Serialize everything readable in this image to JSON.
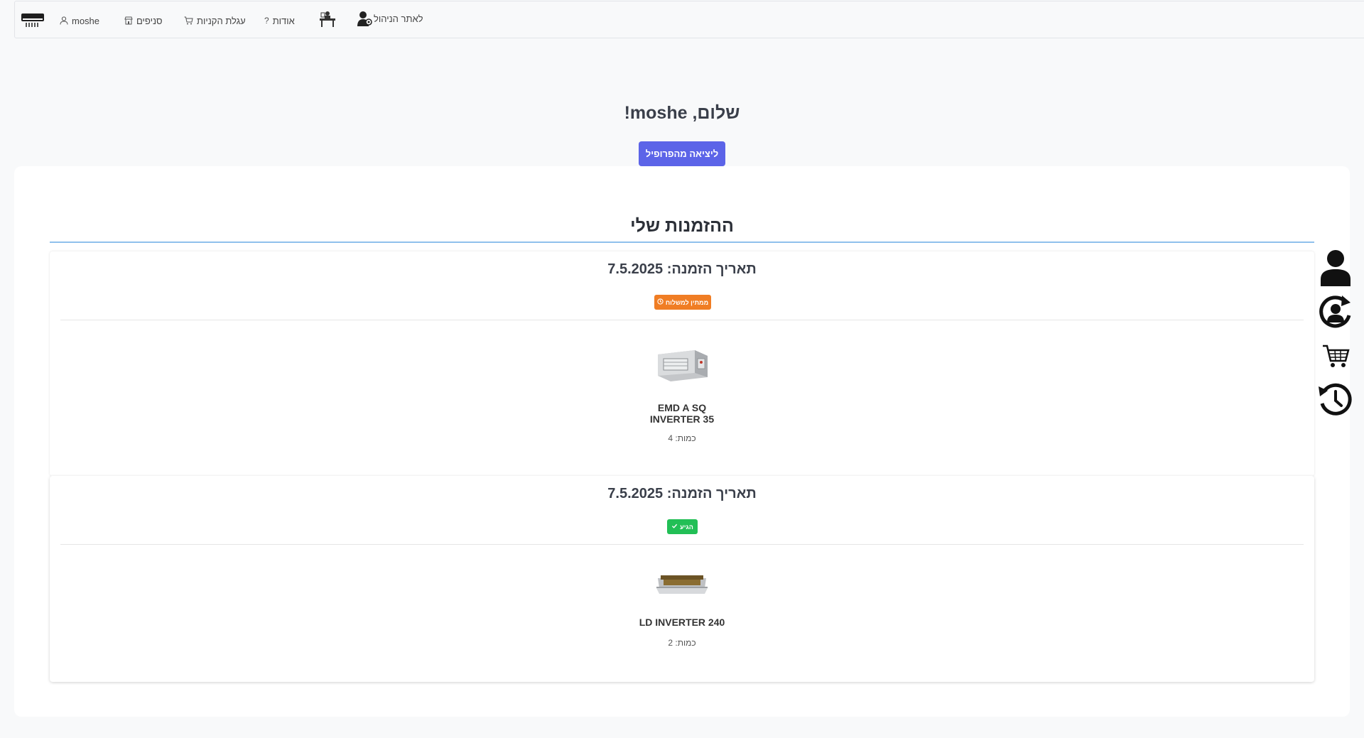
{
  "nav": {
    "logo_icon": "air-conditioner-icon",
    "user_label": "moshe",
    "categories_label": "סניפים",
    "cart_label": "עגלת הקניות",
    "about_label": "אודות",
    "workshop_icon": "technician-icon",
    "admin_label": "לאתר הניהול"
  },
  "greeting": "שלום, moshe!",
  "logout_label": "ליציאה מהפרופיל",
  "orders_title": "ההזמנות שלי",
  "orders": [
    {
      "date": "תאריך הזמנה: 7.5.2025",
      "status": "ממתין למשלוח",
      "status_icon": "clock-icon",
      "status_color": "#f07d24",
      "product_name": "EMD A SQ INVERTER 35",
      "quantity": "כמות: 4"
    },
    {
      "date": "תאריך הזמנה: 7.5.2025",
      "status": "הגיע",
      "status_icon": "check-icon",
      "status_color": "#22bf56",
      "product_name": "LD INVERTER 240",
      "quantity": "כמות: 2"
    }
  ],
  "side_icons": [
    "user-icon",
    "refresh-user-icon",
    "cart-icon",
    "history-icon"
  ],
  "colors": {
    "accent": "#5c64e8",
    "title_line": "#90c1ec",
    "pending": "#f07d24",
    "delivered": "#22bf56"
  }
}
